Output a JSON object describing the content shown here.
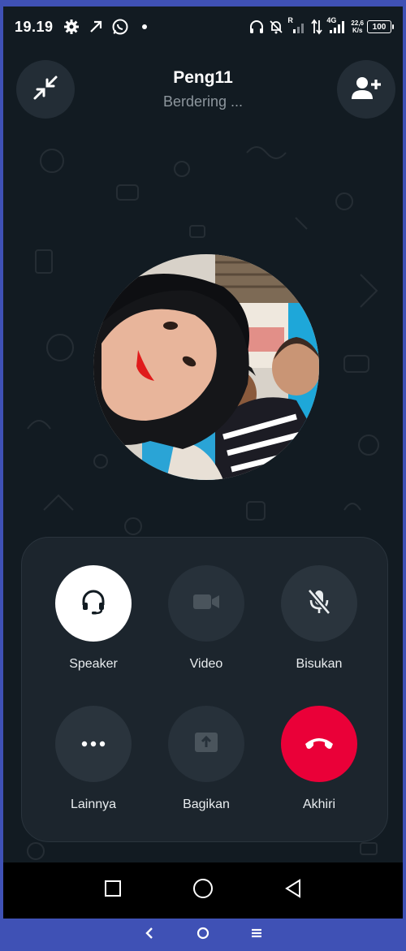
{
  "status_bar": {
    "time": "19.19",
    "left_icons": [
      "gear-icon",
      "arrow-up-right-icon",
      "whatsapp-icon",
      "dot-icon"
    ],
    "right_icons": [
      "headphones-icon",
      "no-bell-icon",
      "signal-r-icon",
      "data-arrows-icon",
      "signal-4g-icon"
    ],
    "signal_r": "R",
    "network": "4G",
    "speed_value": "22,6",
    "speed_unit": "K/s",
    "battery": "100"
  },
  "header": {
    "caller_name": "Peng11",
    "call_status": "Berdering ...",
    "left_button_icon": "minimize-icon",
    "right_button_icon": "add-person-icon"
  },
  "avatar": {
    "description_icon": "caller-avatar"
  },
  "controls": [
    {
      "id": "speaker",
      "label": "Speaker",
      "icon": "headset-icon",
      "state": "active"
    },
    {
      "id": "video",
      "label": "Video",
      "icon": "video-camera-icon",
      "state": "disabled"
    },
    {
      "id": "mute",
      "label": "Bisukan",
      "icon": "mic-off-icon",
      "state": "normal"
    },
    {
      "id": "more",
      "label": "Lainnya",
      "icon": "more-dots-icon",
      "state": "normal"
    },
    {
      "id": "share",
      "label": "Bagikan",
      "icon": "share-screen-icon",
      "state": "disabled"
    },
    {
      "id": "end",
      "label": "Akhiri",
      "icon": "end-call-icon",
      "state": "end"
    }
  ],
  "colors": {
    "background": "#121b22",
    "panel": "#1c252d",
    "end_call": "#ea0038",
    "outer_frame": "#3f51b5"
  },
  "system_nav": [
    "recents-square-icon",
    "home-circle-icon",
    "back-triangle-icon"
  ],
  "bottom_nav": [
    "back-chevron-icon",
    "home-ring-icon",
    "menu-lines-icon"
  ]
}
